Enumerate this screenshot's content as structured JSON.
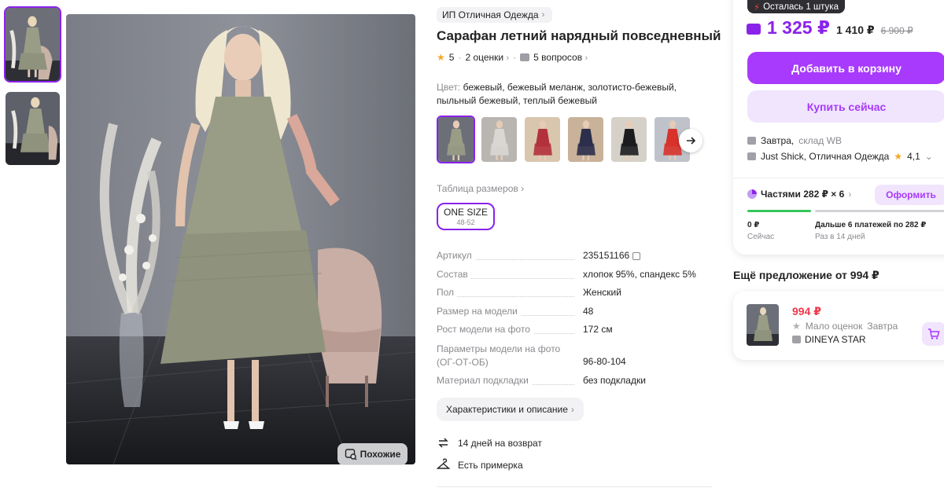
{
  "gallery": {
    "similar_label": "Похожие"
  },
  "product": {
    "brand": "ИП Отличная Одежда",
    "title": "Сарафан летний нарядный повседневный",
    "rating": "5",
    "reviews": "2 оценки",
    "questions": "5 вопросов",
    "color_label": "Цвет:",
    "color_value": "бежевый, бежевый меланж, золотисто-бежевый, пыльный бежевый, теплый бежевый",
    "swatch_colors": [
      "#9a9d86",
      "#d9d7d3",
      "#b3313c",
      "#2b2f4c",
      "#1c1c1f",
      "#d8322b"
    ],
    "size_table_label": "Таблица размеров",
    "size": {
      "name": "ONE SIZE",
      "range": "48-52"
    }
  },
  "specs": [
    {
      "key": "Артикул",
      "value": "235151166"
    },
    {
      "key": "Состав",
      "value": "хлопок 95%, спандекс 5%"
    },
    {
      "key": "Пол",
      "value": "Женский"
    },
    {
      "key": "Размер на модели",
      "value": "48"
    },
    {
      "key": "Рост модели на фото",
      "value": "172 см"
    },
    {
      "key": "Параметры модели на фото (ОГ-ОТ-ОБ)",
      "value": "96-80-104"
    },
    {
      "key": "Материал подкладки",
      "value": "без подкладки"
    }
  ],
  "characteristics_button": "Характеристики и описание",
  "perks": {
    "returns": "14 дней на возврат",
    "fitting": "Есть примерка"
  },
  "buy": {
    "stock_badge": "Осталась 1 штука",
    "price": "1 325 ₽",
    "price_alt": "1 410 ₽",
    "price_old": "6 900 ₽",
    "add_to_cart": "Добавить в корзину",
    "buy_now": "Купить сейчас",
    "delivery_day": "Завтра,",
    "delivery_warehouse": "склад WB",
    "seller": "Just Shick, Отличная Одежда",
    "seller_rating": "4,1",
    "split_label": "Частями 282 ₽ × 6",
    "split_button": "Оформить",
    "split_now_amount": "0 ₽",
    "split_now_label": "Сейчас",
    "split_later_amount": "Дальше 6 платежей по 282 ₽",
    "split_later_label": "Раз в 14 дней",
    "colors": {
      "accent": "#a73afd",
      "accent_light": "#f0e5fd",
      "price": "#8b22ea",
      "success": "#34c759"
    }
  },
  "offer": {
    "title": "Ещё предложение от 994 ₽",
    "price": "994 ₽",
    "rating_text": "Мало оценок",
    "delivery": "Завтра",
    "seller": "DINEYA STAR",
    "price_color": "#f1374a"
  }
}
